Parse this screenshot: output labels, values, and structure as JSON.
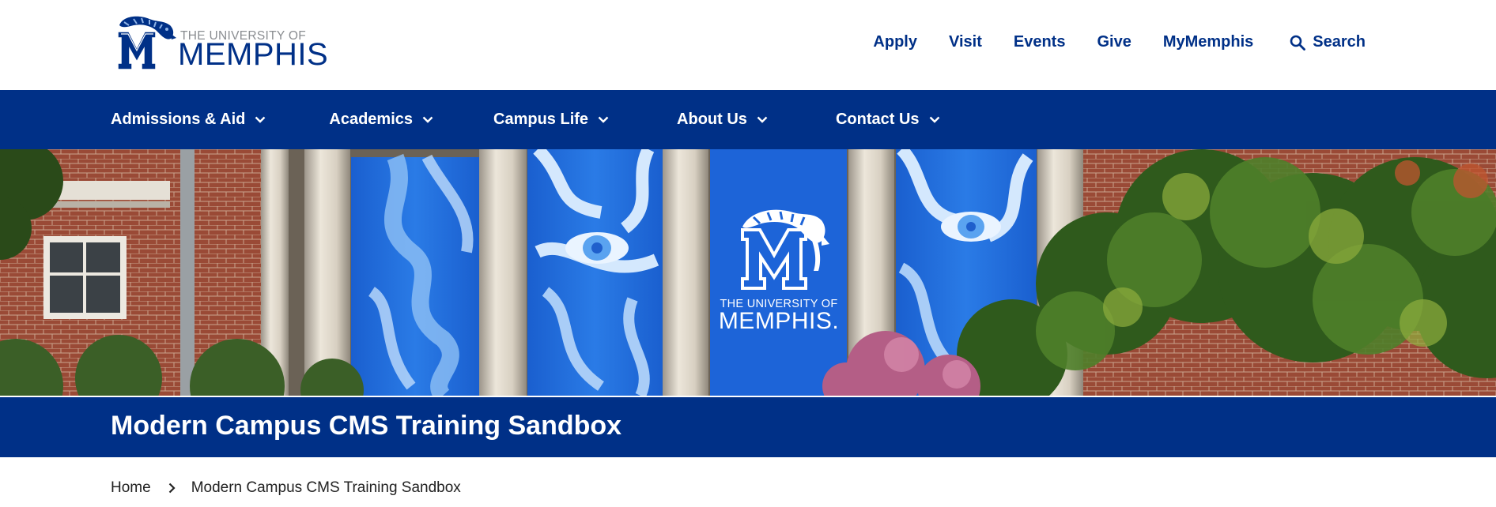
{
  "logo": {
    "line1": "THE UNIVERSITY OF",
    "line2": "MEMPHIS",
    "emblem_icon": "tiger-m-logo-icon"
  },
  "utility_nav": {
    "items": [
      "Apply",
      "Visit",
      "Events",
      "Give",
      "MyMemphis"
    ],
    "search_label": "Search",
    "search_icon": "search-icon"
  },
  "main_nav": {
    "items": [
      {
        "label": "Admissions & Aid",
        "icon": "chevron-down-icon"
      },
      {
        "label": "Academics",
        "icon": "chevron-down-icon"
      },
      {
        "label": "Campus Life",
        "icon": "chevron-down-icon"
      },
      {
        "label": "About Us",
        "icon": "chevron-down-icon"
      },
      {
        "label": "Contact Us",
        "icon": "chevron-down-icon"
      }
    ]
  },
  "hero": {
    "banner_line1": "THE UNIVERSITY OF",
    "banner_line2": "MEMPHIS."
  },
  "page_title": "Modern Campus CMS Training Sandbox",
  "breadcrumb": {
    "home": "Home",
    "current": "Modern Campus CMS Training Sandbox",
    "separator_icon": "chevron-right-icon"
  },
  "colors": {
    "brand_blue": "#003087",
    "banner_blue": "#1e6fd6",
    "text_dark": "#222222"
  }
}
